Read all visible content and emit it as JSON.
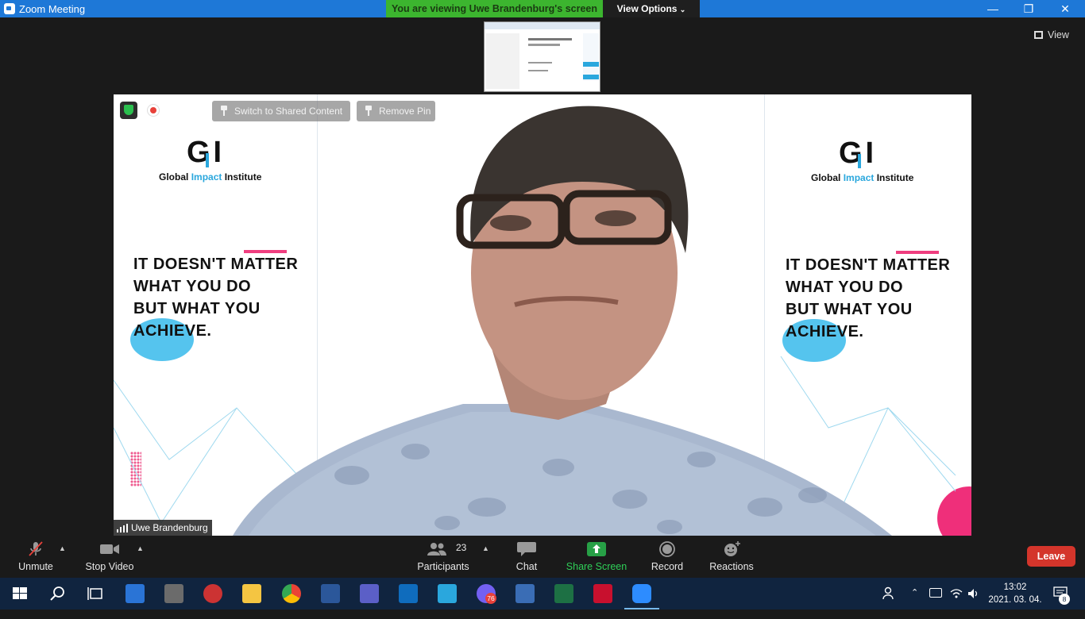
{
  "window": {
    "title": "Zoom Meeting",
    "viewing_banner": "You are viewing Uwe Brandenburg's screen",
    "view_options": "View Options",
    "minimize_glyph": "—",
    "maximize_glyph": "❐",
    "close_glyph": "✕"
  },
  "stage": {
    "view_label": "View",
    "pill_switch": "Switch to Shared Content",
    "pill_remove_pin": "Remove Pin",
    "participant_name": "Uwe Brandenburg"
  },
  "background": {
    "logo_mark": "GI",
    "logo_word1": "Global",
    "logo_word2": "Impact",
    "logo_word3": "Institute",
    "slogan_line1": "IT DOESN'T MATTER",
    "slogan_line2": "WHAT YOU DO",
    "slogan_line3": "BUT WHAT YOU",
    "slogan_line4": "ACHIEVE."
  },
  "controls": {
    "unmute": "Unmute",
    "stop_video": "Stop Video",
    "participants": "Participants",
    "participants_count": "23",
    "chat": "Chat",
    "share_screen": "Share Screen",
    "record": "Record",
    "reactions": "Reactions",
    "leave": "Leave"
  },
  "taskbar": {
    "time": "13:02",
    "date": "2021. 03. 04.",
    "viber_badge": "76",
    "notifications_badge": "8"
  },
  "colors": {
    "titlebar": "#1e78d7",
    "banner_green": "#3cb52f",
    "leave_red": "#d4352b",
    "share_green": "#27a046",
    "taskbar": "#10243f",
    "brand_blue": "#2aa7dd",
    "brand_pink": "#ef3e7f"
  }
}
